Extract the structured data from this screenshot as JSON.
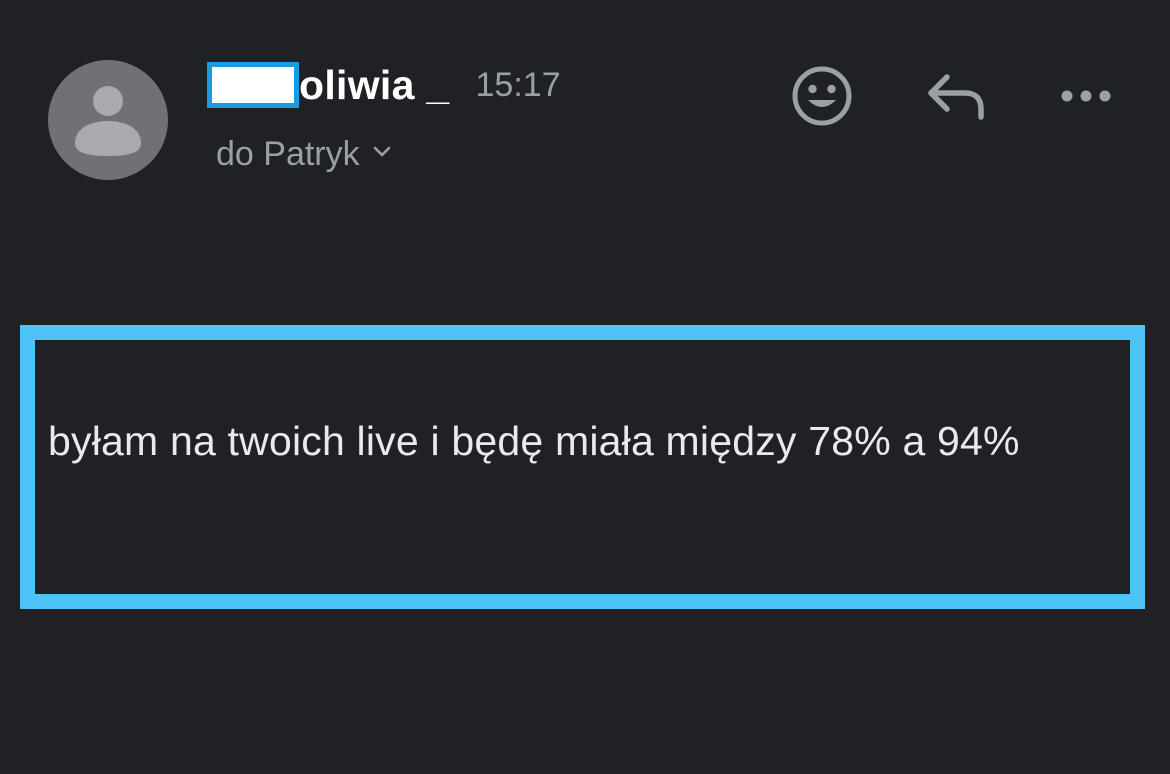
{
  "email": {
    "sender": {
      "name": "oliwia _",
      "avatar_icon": "person-icon"
    },
    "timestamp": "15:17",
    "recipient_label": "do Patryk",
    "body": "byłam na twoich live i będę miała między 78% a 94%"
  },
  "toolbar": {
    "emoji_icon": "smiley-face-icon",
    "reply_icon": "reply-arrow-icon",
    "more_icon": "more-options-icon"
  },
  "colors": {
    "background": "#202124",
    "highlight_border": "#4dc3f7",
    "redaction_border": "#1a9be0",
    "secondary_text": "#9aa0a6",
    "primary_text": "#e8eaed"
  }
}
